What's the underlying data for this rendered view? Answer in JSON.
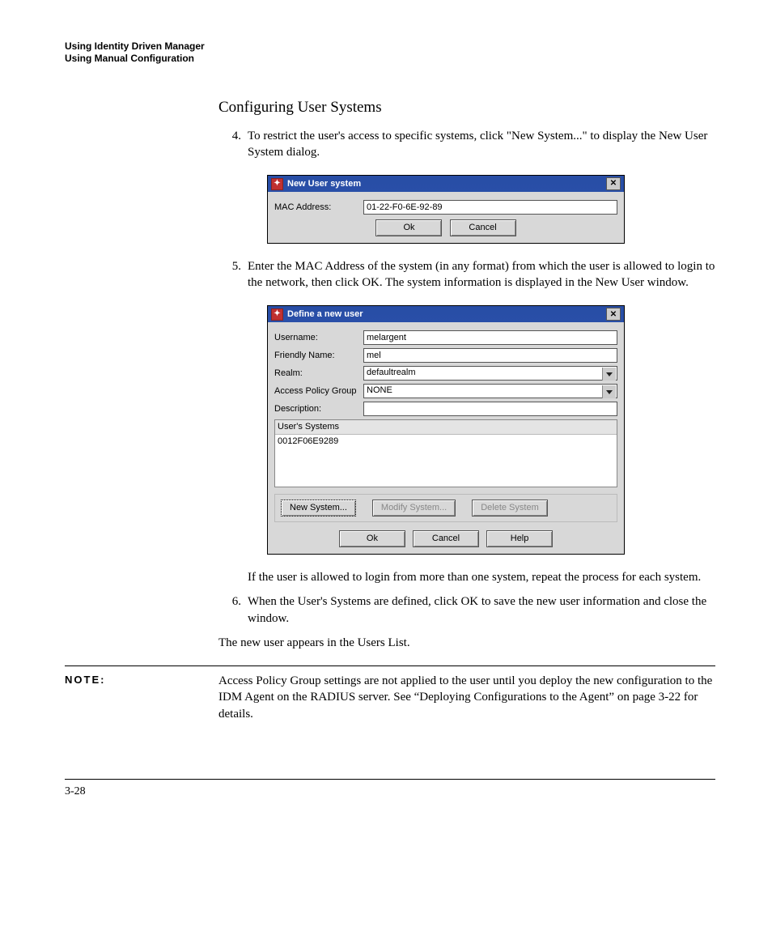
{
  "header": {
    "line1": "Using Identity Driven Manager",
    "line2": "Using Manual Configuration"
  },
  "section_title": "Configuring User Systems",
  "steps": {
    "s4": {
      "num": "4.",
      "text": "To restrict the user's access to specific systems, click \"New System...\" to display the New User System dialog."
    },
    "s5": {
      "num": "5.",
      "text": "Enter the MAC Address of the system (in any format) from which the user is allowed to login to the network, then click OK. The system information is displayed in the New User window."
    },
    "s5b": "If the user is allowed to login from more than one system, repeat the process for each system.",
    "s6": {
      "num": "6.",
      "text": "When the User's Systems are defined, click OK to save the new user information and close the window."
    }
  },
  "after_steps": "The new user appears in the Users List.",
  "note": {
    "label": "NOTE:",
    "text": "Access Policy Group settings are not applied to the user until you deploy the new configuration to the IDM Agent on the RADIUS server. See “Deploying Configurations to the Agent” on page 3-22 for details."
  },
  "page_number": "3-28",
  "dialog1": {
    "title": "New User system",
    "mac_label": "MAC Address:",
    "mac_value": "01-22-F0-6E-92-89",
    "ok": "Ok",
    "cancel": "Cancel"
  },
  "dialog2": {
    "title": "Define a new user",
    "username_label": "Username:",
    "username_value": "melargent",
    "friendly_label": "Friendly Name:",
    "friendly_value": "mel",
    "realm_label": "Realm:",
    "realm_value": "defaultrealm",
    "apg_label": "Access Policy Group",
    "apg_value": "NONE",
    "desc_label": "Description:",
    "desc_value": "",
    "systems_header": "User's Systems",
    "systems_row": "0012F06E9289",
    "btn_new": "New System...",
    "btn_mod": "Modify System...",
    "btn_del": "Delete System",
    "ok": "Ok",
    "cancel": "Cancel",
    "help": "Help"
  }
}
